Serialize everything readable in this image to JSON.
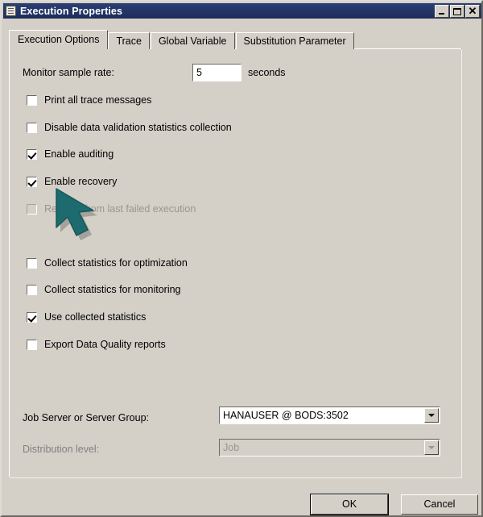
{
  "window": {
    "title": "Execution Properties",
    "icon": "window-document-icon",
    "controls": {
      "minimize": "_",
      "maximize": "□",
      "close": "✕"
    }
  },
  "tabs": [
    {
      "label": "Execution Options",
      "active": true
    },
    {
      "label": "Trace",
      "active": false
    },
    {
      "label": "Global Variable",
      "active": false
    },
    {
      "label": "Substitution Parameter",
      "active": false
    }
  ],
  "form": {
    "sample_rate_label": "Monitor sample rate:",
    "sample_rate_value": "5",
    "sample_rate_units": "seconds",
    "job_server_label": "Job Server or Server Group:",
    "job_server_value": "HANAUSER @ BODS:3502",
    "distribution_level_label": "Distribution level:",
    "distribution_level_value": "Job",
    "distribution_level_disabled": true
  },
  "checkboxes": [
    {
      "label": "Print all trace messages",
      "checked": false,
      "disabled": false
    },
    {
      "label": "Disable data validation statistics collection",
      "checked": false,
      "disabled": false
    },
    {
      "label": "Enable auditing",
      "checked": true,
      "disabled": false
    },
    {
      "label": "Enable recovery",
      "checked": true,
      "disabled": false
    },
    {
      "label": "Recover from last failed execution",
      "checked": false,
      "disabled": true
    },
    {
      "label": "Collect statistics for optimization",
      "checked": false,
      "disabled": false
    },
    {
      "label": "Collect statistics for monitoring",
      "checked": false,
      "disabled": false
    },
    {
      "label": "Use collected statistics",
      "checked": true,
      "disabled": false
    },
    {
      "label": "Export Data Quality reports",
      "checked": false,
      "disabled": false
    }
  ],
  "buttons": {
    "ok": "OK",
    "cancel": "Cancel"
  },
  "colors": {
    "titlebar": "#1c2c5b",
    "dialog": "#d4d0c8",
    "cursor": "#1d6b6e"
  }
}
